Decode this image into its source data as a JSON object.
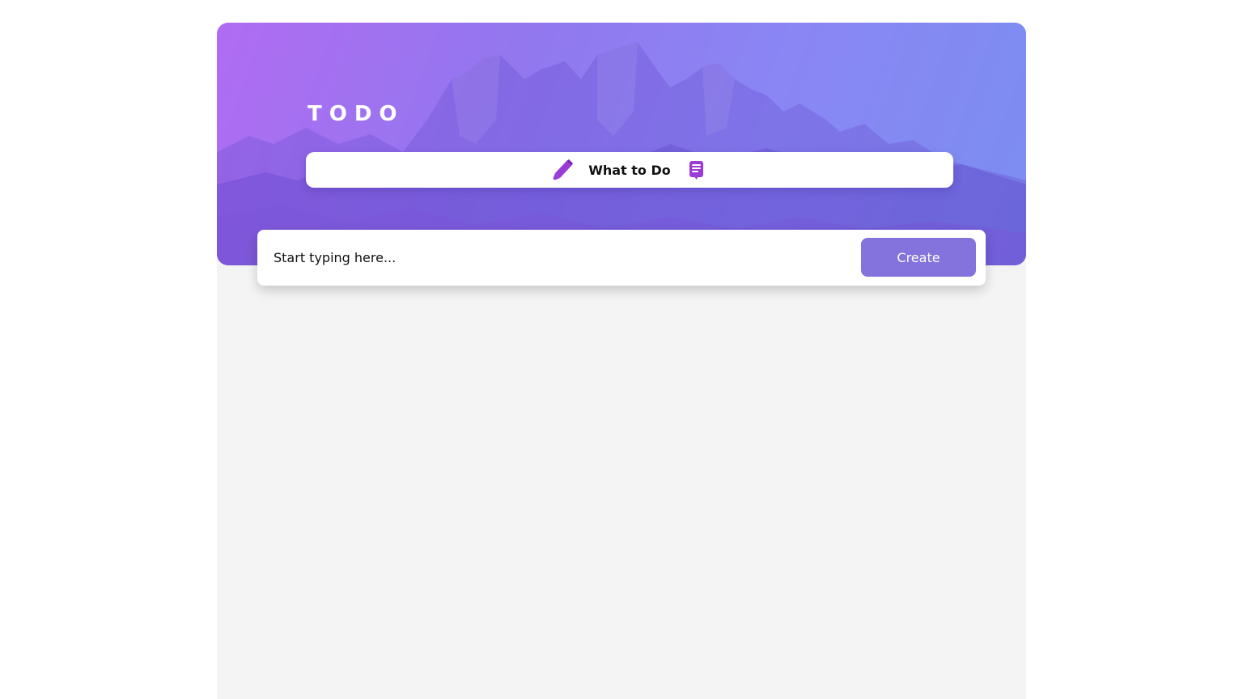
{
  "app": {
    "title": "TODO"
  },
  "banner": {
    "text": "What to Do",
    "left_icon": "pencil-icon",
    "right_icon": "notepad-icon"
  },
  "todo_form": {
    "placeholder": "Start typing here...",
    "create_label": "Create"
  },
  "colors": {
    "accent": "#8473dc",
    "icon": "#9b3bd6",
    "gradient_start": "#b06cf2",
    "gradient_end": "#7b8ef0",
    "list_background": "#f4f4f4"
  }
}
